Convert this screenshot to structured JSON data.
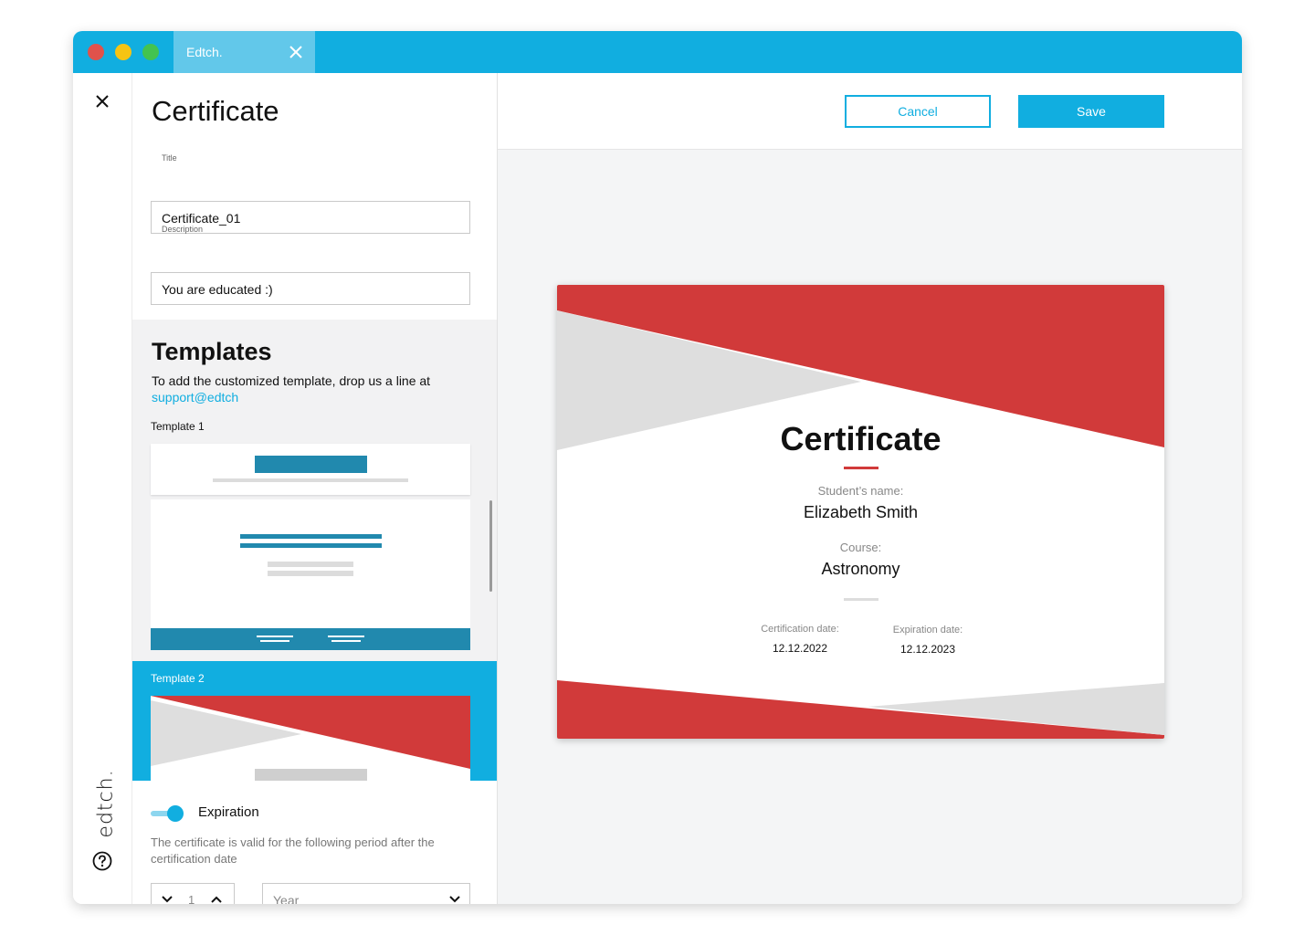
{
  "window": {
    "tab_title": "Edtch."
  },
  "rail": {
    "logo_text": "edtch."
  },
  "toolbar": {
    "cancel_label": "Cancel",
    "save_label": "Save"
  },
  "form": {
    "heading": "Certificate",
    "title_label": "Title",
    "title_value": "Certificate_01",
    "description_label": "Description",
    "description_value": "You are educated :)"
  },
  "templates": {
    "heading": "Templates",
    "description": "To add the customized template, drop us a line at",
    "support_link": "support@edtch",
    "items": [
      {
        "label": "Template 1",
        "selected": false
      },
      {
        "label": "Template 2",
        "selected": true
      }
    ]
  },
  "expiration": {
    "label": "Expiration",
    "enabled": true,
    "description": "The certificate is valid for the following period after the certification date",
    "period_value": "1",
    "period_unit": "Year"
  },
  "certificate": {
    "title": "Certificate",
    "student_label": "Student’s name:",
    "student_name": "Elizabeth Smith",
    "course_label": "Course:",
    "course_name": "Astronomy",
    "cert_date_label": "Certification date:",
    "cert_date": "12.12.2022",
    "exp_date_label": "Expiration date:",
    "exp_date": "12.12.2023"
  },
  "colors": {
    "accent": "#11aee0",
    "certificate_red": "#d13a3a",
    "certificate_grey": "#dedede",
    "template1_blue": "#2189ae"
  },
  "icons": {
    "tab_close": "close-icon",
    "rail_close": "close-icon",
    "help": "help-icon",
    "stepper_down": "chevron-down-icon",
    "stepper_up": "chevron-up-icon",
    "select": "chevron-down-icon"
  }
}
